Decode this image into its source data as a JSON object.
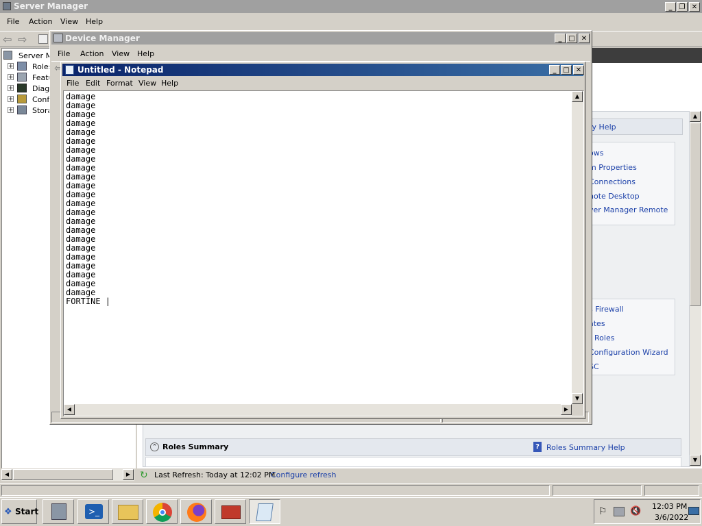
{
  "server_manager": {
    "title": "Server Manager",
    "menu": [
      "File",
      "Action",
      "View",
      "Help"
    ],
    "tree": [
      {
        "label": "Server Ma"
      },
      {
        "label": "Roles"
      },
      {
        "label": "Featu"
      },
      {
        "label": "Diagn"
      },
      {
        "label": "Confi"
      },
      {
        "label": "Stora"
      }
    ],
    "right_links": [
      "ry Help",
      "ows",
      "m Properties",
      "Connections",
      "note Desktop",
      "ver Manager Remote"
    ],
    "right_links2": [
      "s Firewall",
      "ates",
      "r Roles",
      "Configuration Wizard",
      "SC"
    ],
    "roles_summary": {
      "title": "Roles Summary",
      "help": "Roles Summary Help"
    },
    "last_refresh": "Last Refresh: Today at 12:02 PM",
    "configure_refresh": "Configure refresh"
  },
  "device_manager": {
    "title": "Device Manager",
    "menu": [
      "File",
      "Action",
      "View",
      "Help"
    ]
  },
  "notepad": {
    "title": "Untitled - Notepad",
    "menu": [
      "File",
      "Edit",
      "Format",
      "View",
      "Help"
    ],
    "content": "damage\ndamage\ndamage\ndamage\ndamage\ndamage\ndamage\ndamage\ndamage\ndamage\ndamage\ndamage\ndamage\ndamage\ndamage\ndamage\ndamage\ndamage\ndamage\ndamage\ndamage\ndamage\ndamage\nFORTINE |"
  },
  "taskbar": {
    "start": "Start",
    "time": "12:03 PM",
    "date": "3/6/2022"
  }
}
